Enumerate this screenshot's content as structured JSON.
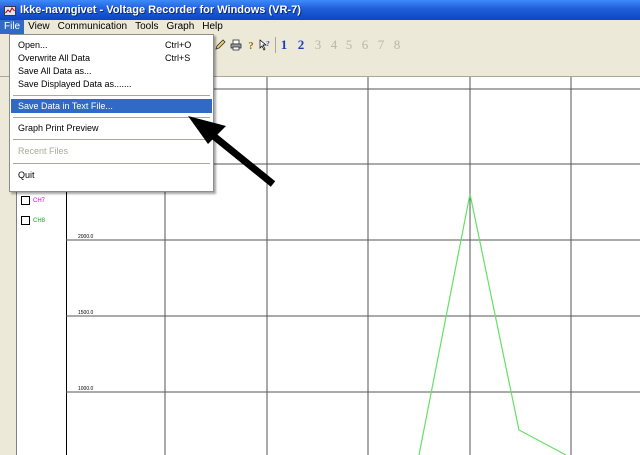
{
  "window": {
    "title": "Ikke-navngivet - Voltage Recorder for Windows (VR-7)"
  },
  "menubar": {
    "items": [
      {
        "label": "File"
      },
      {
        "label": "View"
      },
      {
        "label": "Communication"
      },
      {
        "label": "Tools"
      },
      {
        "label": "Graph"
      },
      {
        "label": "Help"
      }
    ]
  },
  "file_menu": {
    "items": [
      {
        "label": "Open...",
        "shortcut": "Ctrl+O"
      },
      {
        "label": "Overwrite All Data",
        "shortcut": "Ctrl+S"
      },
      {
        "label": "Save All Data as...",
        "shortcut": ""
      },
      {
        "label": "Save Displayed Data as.......",
        "shortcut": ""
      },
      {
        "label": "Save Data in Text File...",
        "shortcut": ""
      },
      {
        "label": "Graph Print Preview",
        "shortcut": ""
      },
      {
        "label": "Recent Files",
        "shortcut": ""
      },
      {
        "label": "Quit",
        "shortcut": ""
      }
    ]
  },
  "toolbar": {
    "channels": [
      "1",
      "2",
      "3",
      "4",
      "5",
      "6",
      "7",
      "8"
    ],
    "active_channels": [
      "1",
      "2"
    ]
  },
  "legend": {
    "items": [
      {
        "label": "CH7",
        "color": "#e000e0"
      },
      {
        "label": "CH8",
        "color": "#00b000"
      }
    ]
  },
  "graph": {
    "y_ticks": [
      "2000.0",
      "1500.0",
      "1000.0"
    ],
    "line_color": "#66e066"
  },
  "colors": {
    "titlebar": "#0a46c7",
    "highlight": "#316ac5",
    "arrow": "#000000"
  }
}
